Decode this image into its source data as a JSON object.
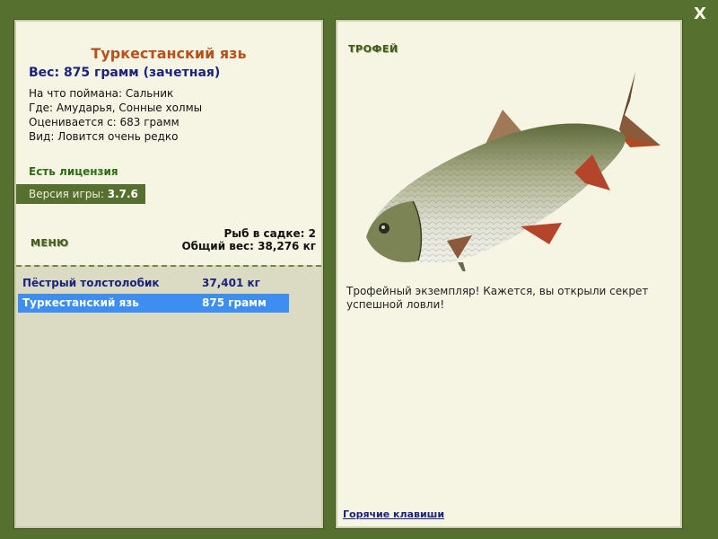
{
  "close_label": "X",
  "fish": {
    "title": "Туркестанский язь",
    "weight_line": "Вес: 875 грамм (зачетная)",
    "details": [
      "На что поймана: Сальник",
      "Где: Амударья, Сонные холмы",
      "Оценивается с: 683 грамм",
      "Вид: Ловится очень редко"
    ]
  },
  "license_text": "Есть лицензия",
  "version": {
    "label": "Версия игры:",
    "value": "3.7.6"
  },
  "menu_label": "МЕНЮ",
  "keepnet": {
    "count_line": "Рыб в садке: 2",
    "total_line": "Общий вес: 38,276 кг"
  },
  "catch_list": [
    {
      "name": "Пёстрый толстолобик",
      "weight": "37,401 кг",
      "selected": false
    },
    {
      "name": "Туркестанский язь",
      "weight": "875 грамм",
      "selected": true
    }
  ],
  "trophy": {
    "label": "ТРОФЕЙ",
    "description": "Трофейный экземпляр! Кажется, вы открыли секрет успешной ловли!"
  },
  "hotkeys_link": "Горячие клавиши",
  "colors": {
    "frame": "#56702f",
    "panel": "#f6f5e4",
    "title": "#b8501a",
    "selected_row": "#3d8ef0"
  }
}
